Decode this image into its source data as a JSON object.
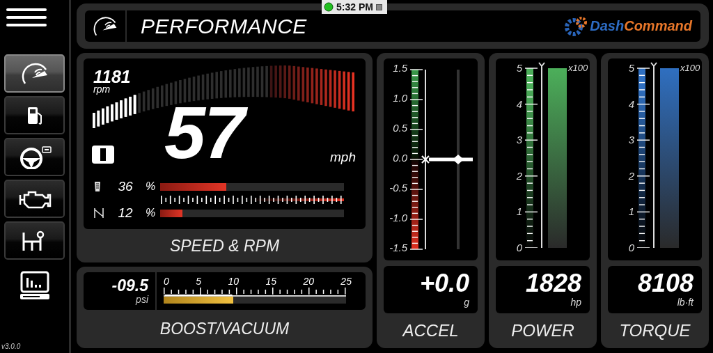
{
  "header": {
    "title": "PERFORMANCE",
    "logo": [
      "Dash",
      "Command"
    ]
  },
  "clock": {
    "time": "5:32 PM"
  },
  "nav": [
    {
      "selected": true
    },
    {
      "selected": false
    },
    {
      "selected": false
    },
    {
      "selected": false
    },
    {
      "selected": false
    }
  ],
  "version": "v3.0.0",
  "speed": {
    "title": "SPEED & RPM",
    "rpm": {
      "value": "1181",
      "unit": "rpm",
      "level": 0.17
    },
    "speed": "57",
    "speed_unit": "mph",
    "bars": [
      {
        "value": "36",
        "unit": "%",
        "level": 0.36
      },
      {
        "value": "12",
        "unit": "%",
        "level": 0.12
      }
    ]
  },
  "boost": {
    "title": "BOOST/VACUUM",
    "value": "-09.5",
    "unit": "psi",
    "scale": [
      "0",
      "5",
      "10",
      "15",
      "20",
      "25"
    ],
    "level": 0.38
  },
  "gauges": [
    {
      "kind": "accel",
      "title": "ACCEL",
      "value": "+0.0",
      "unit": "g",
      "scale": [
        "1.5",
        "1.0",
        "0.5",
        "0.0",
        "-0.5",
        "-1.0",
        "-1.5"
      ],
      "level": 0.5
    },
    {
      "kind": "bar",
      "title": "POWER",
      "value": "1828",
      "unit": "hp",
      "scale": [
        "5",
        "4",
        "3",
        "2",
        "1",
        "0"
      ],
      "multiplier": "x100",
      "level": 1,
      "color": "#4caf5a"
    },
    {
      "kind": "bar",
      "title": "TORQUE",
      "value": "8108",
      "unit": "lb·ft",
      "scale": [
        "5",
        "4",
        "3",
        "2",
        "1",
        "0"
      ],
      "multiplier": "x100",
      "level": 1,
      "color": "#2f6fc0"
    }
  ]
}
